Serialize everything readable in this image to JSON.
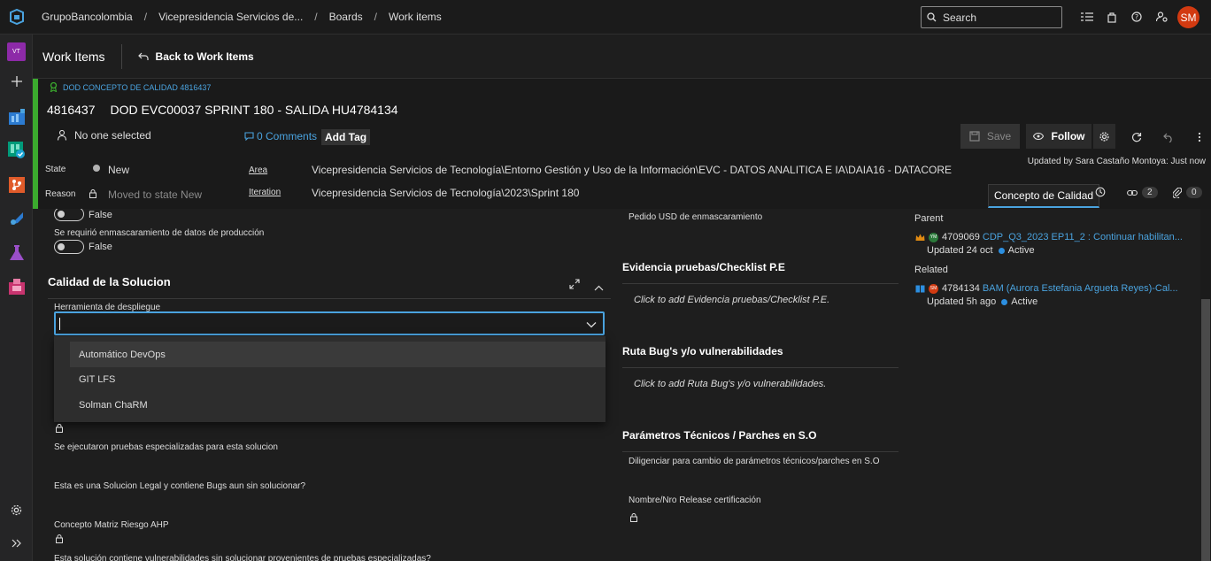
{
  "breadcrumb": [
    "GrupoBancolombia",
    "Vicepresidencia Servicios de...",
    "Boards",
    "Work items"
  ],
  "search": {
    "placeholder": "Search"
  },
  "user": {
    "initials": "SM",
    "avatar_color": "#d23a11"
  },
  "rail": {
    "project_initials": "VT"
  },
  "header": {
    "title": "Work Items",
    "back_label": "Back to Work Items"
  },
  "work_item": {
    "type_label": "DOD CONCEPTO DE CALIDAD 4816437",
    "id": "4816437",
    "title": "DOD EVC00037 SPRINT 180 - SALIDA HU4784134",
    "assignee": "No one selected",
    "comments": "0 Comments",
    "add_tag": "Add Tag",
    "save_label": "Save",
    "follow_label": "Follow",
    "updated_by": "Updated by Sara Castaño Montoya: Just now",
    "state_label": "State",
    "state_value": "New",
    "reason_label": "Reason",
    "reason_value": "Moved to state New",
    "area_label": "Area",
    "area_value": "Vicepresidencia Servicios de Tecnología\\Entorno Gestión y Uso de la Información\\EVC - DATOS ANALITICA E IA\\DAIA16 - DATACORE",
    "iteration_label": "Iteration",
    "iteration_value": "Vicepresidencia Servicios de Tecnología\\2023\\Sprint 180",
    "tab_label": "Concepto de Calidad",
    "links_count": "2",
    "attachments_count": "0",
    "accent_color": "#3bab2e"
  },
  "left_col": {
    "toggle1_value": "False",
    "toggle2_label": "Se requirió enmascaramiento de datos de producción",
    "toggle2_value": "False",
    "section_title": "Calidad de la Solucion",
    "field_label": "Herramienta de despliegue",
    "options": [
      "Automático DevOps",
      "GIT LFS",
      "Solman ChaRM"
    ],
    "q1": "Se ejecutaron pruebas especializadas para esta solucion",
    "q2": "Esta es una Solucion Legal y contiene Bugs aun sin solucionar?",
    "q3": "Concepto Matriz Riesgo AHP",
    "q4": "Esta solución contiene vulnerabilidades sin solucionar provenientes de pruebas especializadas?"
  },
  "mid_col": {
    "pedido": "Pedido USD de enmascaramiento",
    "sec1": "Evidencia pruebas/Checklist P.E",
    "sec1_placeholder": "Click to add Evidencia pruebas/Checklist P.E.",
    "sec2": "Ruta Bug's y/o vulnerabilidades",
    "sec2_placeholder": "Click to add Ruta Bug's y/o vulnerabilidades.",
    "sec3": "Parámetros Técnicos / Parches en S.O",
    "sec3_desc": "Diligenciar para cambio de parámetros técnicos/parches en S.O",
    "field": "Nombre/Nro Release certificación"
  },
  "right_col": {
    "parent_label": "Parent",
    "parent_id": "4709069",
    "parent_title": "CDP_Q3_2023 EP11_2 : Continuar habilitan...",
    "parent_avatar": "YM",
    "parent_updated": "Updated 24 oct",
    "parent_state": "Active",
    "related_label": "Related",
    "related_id": "4784134",
    "related_title": "BAM (Aurora Estefania Argueta Reyes)-Cal...",
    "related_avatar": "SM",
    "related_updated": "Updated 5h ago",
    "related_state": "Active"
  }
}
